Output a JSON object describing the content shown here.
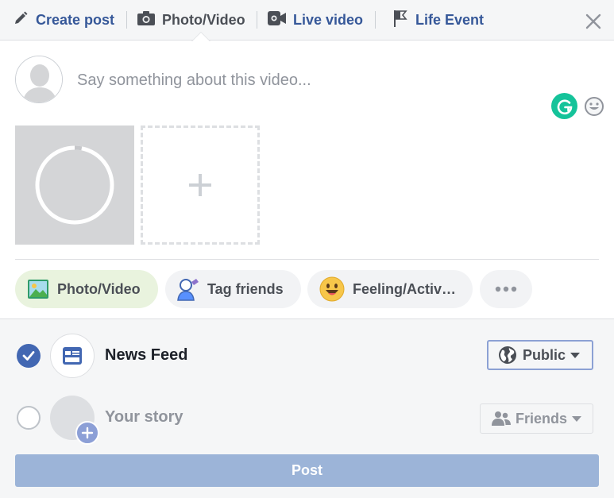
{
  "header": {
    "tabs": [
      {
        "label": "Create post",
        "icon": "pencil-icon"
      },
      {
        "label": "Photo/Video",
        "icon": "camera-icon",
        "active": true
      },
      {
        "label": "Live video",
        "icon": "video-camera-icon"
      },
      {
        "label": "Life Event",
        "icon": "flag-icon"
      }
    ],
    "close_icon": "close-icon"
  },
  "composer": {
    "placeholder": "Say something about this video...",
    "upload_progress": 0.03
  },
  "actions": [
    {
      "label": "Photo/Video",
      "icon": "photo-icon",
      "selected": true
    },
    {
      "label": "Tag friends",
      "icon": "tag-friends-icon"
    },
    {
      "label": "Feeling/Activ…",
      "icon": "smiley-icon"
    },
    {
      "label": "",
      "icon": "more-icon"
    }
  ],
  "destinations": [
    {
      "label": "News Feed",
      "checked": true,
      "privacy": "Public",
      "privacy_icon": "globe-icon"
    },
    {
      "label": "Your story",
      "checked": false,
      "privacy": "Friends",
      "privacy_icon": "friends-icon"
    }
  ],
  "post_button": {
    "label": "Post"
  },
  "colors": {
    "link": "#365899",
    "accent": "#4267b2",
    "post_disabled": "#9cb4d8",
    "grammarly": "#15c39a",
    "photo_pill": "#e9f3de"
  }
}
